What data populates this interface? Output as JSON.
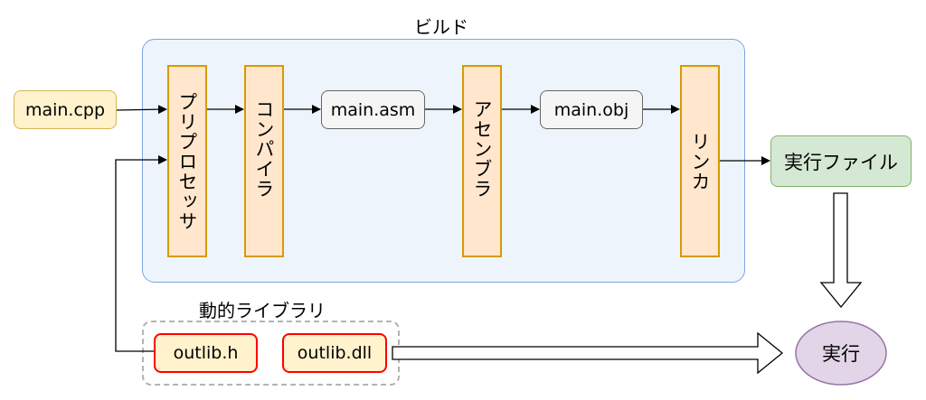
{
  "build": {
    "title": "ビルド"
  },
  "inputs": {
    "source": "main.cpp"
  },
  "stages": {
    "preprocessor": "プリプロセッサ",
    "compiler": "コンパイラ",
    "assembler": "アセンブラ",
    "linker": "リンカ"
  },
  "intermediates": {
    "asm": "main.asm",
    "obj": "main.obj"
  },
  "output": {
    "executable": "実行ファイル"
  },
  "library": {
    "title": "動的ライブラリ",
    "header": "outlib.h",
    "dll": "outlib.dll"
  },
  "run": {
    "label": "実行"
  },
  "colors": {
    "build_fill": "#edf4fc",
    "build_border": "#6c8ebf",
    "stage_fill": "#ffe6cc",
    "stage_border": "#d79b00",
    "file_fill": "#fff2cc",
    "file_border": "#d6b656",
    "inter_fill": "#f5f5f5",
    "inter_border": "#666666",
    "exe_fill": "#d5e8d4",
    "exe_border": "#82b366",
    "run_fill": "#e1d5e7",
    "run_border": "#9673a6",
    "lib_border": "#ff0000"
  }
}
